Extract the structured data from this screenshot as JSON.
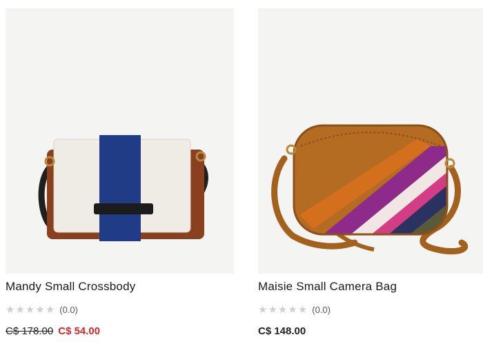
{
  "products": [
    {
      "name": "Mandy Small Crossbody",
      "rating_count": "(0.0)",
      "rating_value": 0,
      "price_original": "C$ 178.00",
      "price_sale": "C$ 54.00"
    },
    {
      "name": "Maisie Small Camera Bag",
      "rating_count": "(0.0)",
      "rating_value": 0,
      "price": "C$ 148.00"
    }
  ],
  "colors": {
    "image_background": "#f4f4f2",
    "sale_price": "#d6262c",
    "star_empty": "#cfcfcf"
  }
}
